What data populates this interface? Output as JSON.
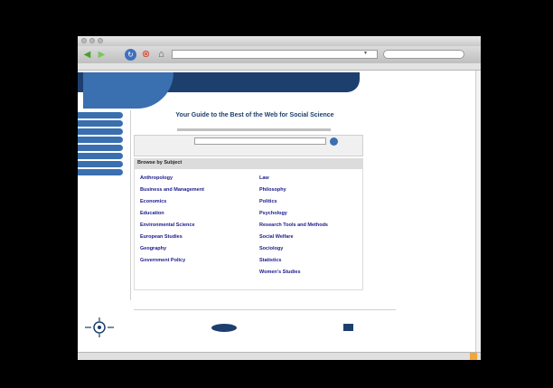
{
  "colors": {
    "brand_navy": "#1c3f6e",
    "brand_blue": "#3a6fb0",
    "link": "#1a1a8c",
    "background": "#000000"
  },
  "toolbar": {
    "back_icon": "back-arrow-icon",
    "forward_icon": "forward-arrow-icon",
    "reload_icon": "reload-icon",
    "stop_icon": "stop-icon",
    "home_icon": "home-icon"
  },
  "site": {
    "tagline": "Your Guide to the Best of the Web for Social Science"
  },
  "browse": {
    "title": "Browse by Subject",
    "left_subjects": [
      "Anthropology",
      "Business and Management",
      "Economics",
      "Education",
      "Environmental Science",
      "European Studies",
      "Geography",
      "Government Policy"
    ],
    "right_subjects": [
      "Law",
      "Philosophy",
      "Politics",
      "Psychology",
      "Research Tools and Methods",
      "Social Welfare",
      "Sociology",
      "Statistics",
      "Women's Studies"
    ]
  }
}
